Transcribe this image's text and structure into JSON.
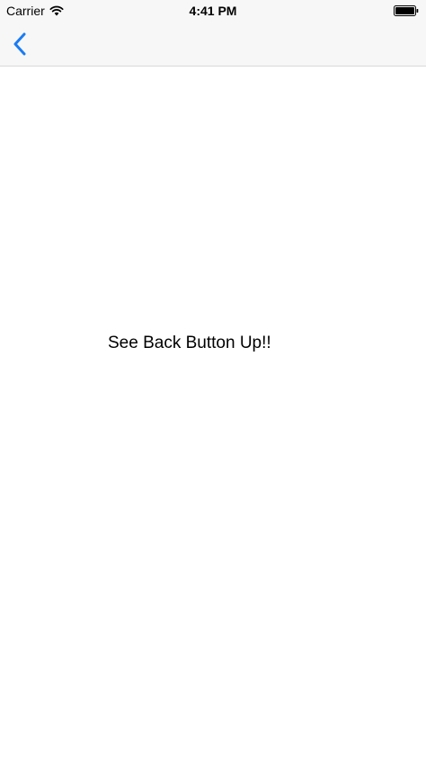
{
  "status_bar": {
    "carrier": "Carrier",
    "time": "4:41 PM",
    "icons": [
      "wifi-icon",
      "battery-icon"
    ]
  },
  "nav_bar": {
    "back_icon": "chevron-left-icon",
    "tint_color": "#1a7cf3",
    "background_color": "#f7f7f7"
  },
  "content": {
    "message": "See Back Button Up!!"
  }
}
